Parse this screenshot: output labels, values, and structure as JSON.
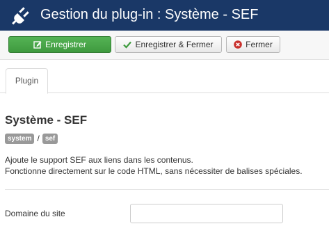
{
  "header": {
    "title": "Gestion du plug-in : Système - SEF",
    "icon": "plug-icon",
    "background": "#1a3867"
  },
  "toolbar": {
    "save_label": "Enregistrer",
    "save_close_label": "Enregistrer & Fermer",
    "close_label": "Fermer",
    "save_color": "#4aa74a",
    "close_icon_color": "#c9302c",
    "check_icon_color": "#3d9b3d"
  },
  "tabs": [
    {
      "label": "Plugin",
      "active": true
    }
  ],
  "plugin": {
    "title": "Système - SEF",
    "folder_badge": "system",
    "separator": "/",
    "element_badge": "sef",
    "description_line1": "Ajoute le support SEF aux liens dans les contenus.",
    "description_line2": "Fonctionne directement sur le code HTML, sans nécessiter de balises spéciales."
  },
  "form": {
    "domain_label": "Domaine du site",
    "domain_value": "",
    "domain_placeholder": ""
  }
}
